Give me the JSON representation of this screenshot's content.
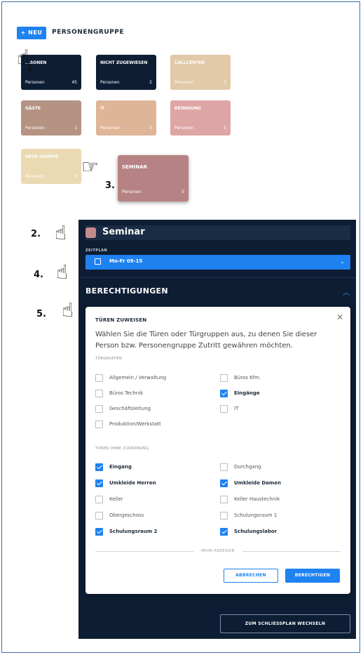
{
  "header": {
    "new_button": "+ NEU",
    "title": "PERSONENGRUPPE"
  },
  "tiles": [
    {
      "name": "...SONEN",
      "sub": "Personen",
      "count": "45",
      "color": "#0d1d33"
    },
    {
      "name": "NICHT ZUGEWIESEN",
      "sub": "Personen",
      "count": "2",
      "color": "#0d1d33"
    },
    {
      "name": "CALLCENTER",
      "sub": "Personen",
      "count": "0",
      "color": "#e2c9a8"
    },
    {
      "name": "GÄSTE",
      "sub": "Personen",
      "count": "1",
      "color": "#b59382"
    },
    {
      "name": "IT",
      "sub": "Personen",
      "count": "3",
      "color": "#dfb598"
    },
    {
      "name": "REINIGUNG",
      "sub": "Personen",
      "count": "5",
      "color": "#dea5a5"
    },
    {
      "name": "NEUE GRUPPE",
      "sub": "Personen",
      "count": "0",
      "color": "#ebd9b2"
    },
    {
      "name": "SEMINAR",
      "sub": "Personen",
      "count": "0",
      "color": "#b78283"
    }
  ],
  "markers": {
    "m1": "1.",
    "m2": "2.",
    "m3": "3.",
    "m4": "4.",
    "m5": "5."
  },
  "panel": {
    "name": "Seminar",
    "zeitplan_label": "ZEITPLAN",
    "zeitplan_value": "Mo-Fr 09-15",
    "berechtigungen": "BERECHTIGUNGEN",
    "bottom_button": "ZUM SCHLIESSPLAN WECHSELN"
  },
  "modal": {
    "title": "TÜREN ZUWEISEN",
    "description": "Wählen Sie die Türen oder Türgruppen aus, zu denen Sie dieser Person bzw. Personengruppe Zutritt gewähren möchten.",
    "section_groups": "TÜRGRUPPEN",
    "groups": [
      {
        "label": "Allgemein / Verwaltung",
        "checked": false
      },
      {
        "label": "Büros Kfm.",
        "checked": false
      },
      {
        "label": "Büros Technik",
        "checked": false
      },
      {
        "label": "Eingänge",
        "checked": true
      },
      {
        "label": "Geschäftsleitung",
        "checked": false
      },
      {
        "label": "IT",
        "checked": false
      },
      {
        "label": "Produktion/Werkstatt",
        "checked": false
      }
    ],
    "section_doors": "TÜREN OHNE ZUORDNUNG",
    "doors": [
      {
        "label": "Eingang",
        "checked": true
      },
      {
        "label": "Durchgang",
        "checked": false
      },
      {
        "label": "Umkleide Herren",
        "checked": true
      },
      {
        "label": "Umkleide Damen",
        "checked": true
      },
      {
        "label": "Keller",
        "checked": false
      },
      {
        "label": "Keller Haustechnik",
        "checked": false
      },
      {
        "label": "Obergeschoss",
        "checked": false
      },
      {
        "label": "Schulungsraum 1",
        "checked": false
      },
      {
        "label": "Schulungsraum 2",
        "checked": true
      },
      {
        "label": "Schulungslabor",
        "checked": true
      }
    ],
    "more": "MEHR ANZEIGEN",
    "cancel": "ABBRECHEN",
    "confirm": "BERECHTIGEN"
  }
}
